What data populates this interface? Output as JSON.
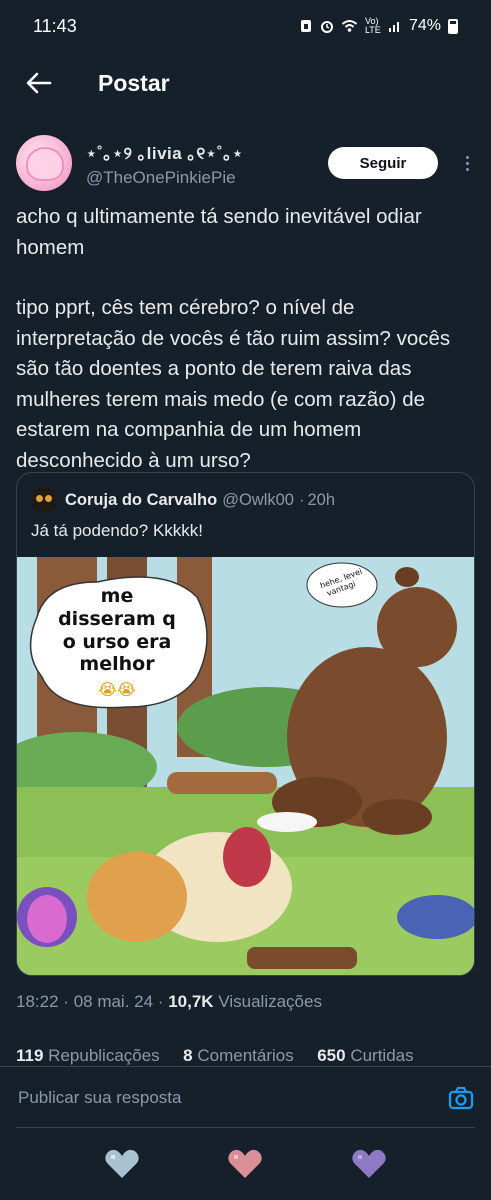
{
  "status_bar": {
    "time": "11:43",
    "battery": "74%",
    "network": "Vo) LTE"
  },
  "header": {
    "title": "Postar",
    "back_icon": "arrow-left-icon"
  },
  "post": {
    "author": {
      "display_name": "⋆˚｡⋆୨ ｡livia ｡୧⋆˚｡⋆",
      "handle": "@TheOnePinkiePie"
    },
    "follow_label": "Seguir",
    "text_paragraphs": [
      "acho q ultimamente tá sendo inevitável odiar homem",
      "tipo pprt, cês tem cérebro? o nível de interpretação de vocês é tão ruim assim? vocês são tão doentes a ponto de terem raiva das mulheres terem mais medo (e com razão) de estarem na companhia de um homem desconhecido à um urso?"
    ],
    "quote": {
      "author_name": "Coruja do Carvalho",
      "handle": "@Owlk00",
      "separator": "·",
      "time": "20h",
      "text": "Já tá podendo? Kkkkk!",
      "image": {
        "bubble_left_lines": [
          "me",
          "disseram q",
          "o urso era",
          "melhor"
        ],
        "bubble_left_emoji": "😭😭",
        "bubble_right_lines": [
          "hehe, levei",
          "vantagi"
        ]
      }
    },
    "meta": {
      "time": "18:22",
      "date": "08 mai. 24",
      "separator": "·",
      "views_count": "10,7K",
      "views_label": "Visualizações"
    },
    "stats": {
      "reposts_count": "119",
      "reposts_label": "Republicações",
      "comments_count": "8",
      "comments_label": "Comentários",
      "likes_count": "650",
      "likes_label": "Curtidas"
    }
  },
  "reply": {
    "placeholder": "Publicar sua resposta",
    "camera_icon": "camera-icon"
  },
  "bottom_nav": {
    "hearts": [
      {
        "icon": "blue-heart-icon",
        "color": "#a9c2cf"
      },
      {
        "icon": "pink-heart-icon",
        "color": "#d98f98"
      },
      {
        "icon": "purple-heart-icon",
        "color": "#8d79c4"
      }
    ]
  },
  "colors": {
    "background": "#15202b",
    "text": "#e7e9ea",
    "secondary": "#8b98a5",
    "accent": "#1d9bf0",
    "border": "#38444d"
  }
}
